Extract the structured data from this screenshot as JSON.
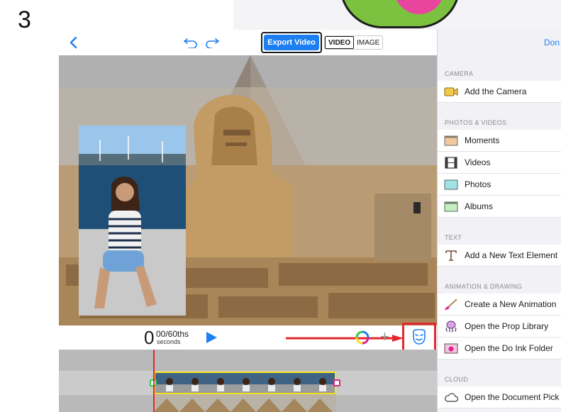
{
  "step_number": "3",
  "toolbar": {
    "export_label": "Export Video",
    "mode_video": "VIDEO",
    "mode_image": "IMAGE",
    "accent": "#1d7ff1"
  },
  "playback": {
    "seconds": "0",
    "fraction": "00/60ths",
    "unit": "seconds"
  },
  "highlight_color": "#e4282e",
  "sidebar": {
    "done_label": "Don",
    "sections": [
      {
        "header": "CAMERA",
        "items": [
          {
            "label": "Add the Camera",
            "icon": "camera-icon"
          }
        ]
      },
      {
        "header": "PHOTOS & VIDEOS",
        "items": [
          {
            "label": "Moments",
            "icon": "moments-folder-icon"
          },
          {
            "label": "Videos",
            "icon": "film-icon"
          },
          {
            "label": "Photos",
            "icon": "photos-folder-icon"
          },
          {
            "label": "Albums",
            "icon": "albums-folder-icon"
          }
        ]
      },
      {
        "header": "TEXT",
        "items": [
          {
            "label": "Add a New Text Element",
            "icon": "text-icon"
          }
        ]
      },
      {
        "header": "ANIMATION & DRAWING",
        "items": [
          {
            "label": "Create a New Animation",
            "icon": "brush-icon"
          },
          {
            "label": "Open the Prop Library",
            "icon": "octopus-icon"
          },
          {
            "label": "Open the Do Ink Folder",
            "icon": "doink-folder-icon"
          }
        ]
      },
      {
        "header": "CLOUD",
        "items": [
          {
            "label": "Open the Document Pick",
            "icon": "cloud-icon"
          }
        ]
      }
    ]
  }
}
